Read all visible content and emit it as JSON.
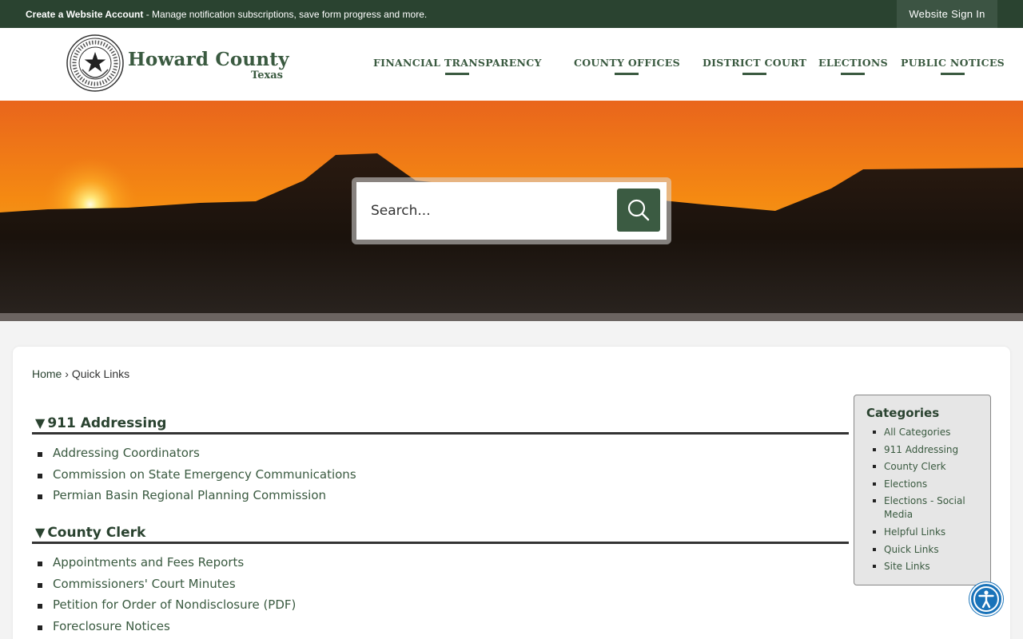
{
  "topbar": {
    "create_account": "Create a Website Account",
    "message": " - Manage notification subscriptions, save form progress and more.",
    "sign_in": "Website Sign In"
  },
  "header": {
    "name": "Howard County",
    "subname": "Texas",
    "nav": [
      {
        "label": "FINANCIAL TRANSPARENCY"
      },
      {
        "label": "COUNTY OFFICES"
      },
      {
        "label": "DISTRICT COURT"
      },
      {
        "label": "ELECTIONS"
      },
      {
        "label": "PUBLIC NOTICES"
      }
    ]
  },
  "search": {
    "placeholder": "Search..."
  },
  "breadcrumb": {
    "home": "Home",
    "separator": " › ",
    "current": "Quick Links"
  },
  "sections": [
    {
      "title": "911 Addressing",
      "links": [
        "Addressing Coordinators",
        "Commission on State Emergency Communications",
        "Permian Basin Regional Planning Commission"
      ]
    },
    {
      "title": "County Clerk",
      "links": [
        "Appointments and Fees Reports",
        "Commissioners' Court Minutes",
        "Petition for Order of Nondisclosure (PDF)",
        "Foreclosure Notices"
      ]
    }
  ],
  "categories": {
    "title": "Categories",
    "items": [
      "All Categories",
      "911 Addressing",
      "County Clerk",
      "Elections",
      "Elections - Social Media",
      "Helpful Links",
      "Quick Links",
      "Site Links"
    ]
  },
  "colors": {
    "brand_dark": "#2a4330",
    "brand": "#3a5a40",
    "accessibility": "#1a73b9"
  }
}
